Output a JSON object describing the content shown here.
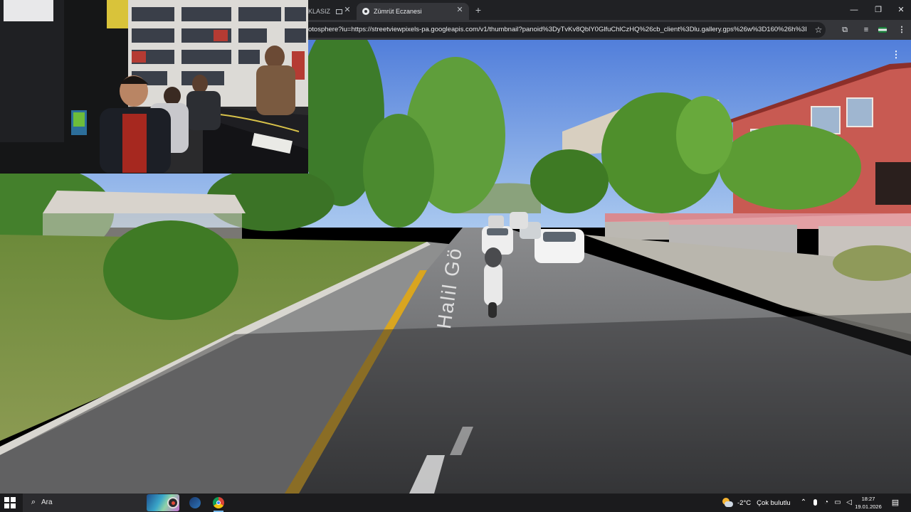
{
  "browser": {
    "tabs": [
      {
        "label": "KLASIZ"
      },
      {
        "label": "Zümrüt Eczanesi"
      }
    ],
    "close_symbol": "✕",
    "new_tab_symbol": "+",
    "window_controls": {
      "minimize": "—",
      "restore": "❐",
      "close": "✕"
    },
    "address": "otosphere?iu=https://streetviewpixels-pa.googleapis.com/v1/thumbnail?panoid%3DyTvKv8QblY0GlfuChlCzHQ%26cb_client%3Dlu.gallery.gps%26w%3D160%26h%3D1...",
    "toolbar_icons": [
      "star-icon",
      "extensions-icon",
      "media-controls-icon",
      "profile-icon",
      "menu-icon"
    ]
  },
  "street_view": {
    "street_label": "Halil Gö",
    "menu_icon": "more-vert-icon"
  },
  "taskbar": {
    "search_placeholder": "Ara",
    "apps": [
      "obs-icon",
      "steam-icon",
      "chrome-icon"
    ],
    "weather": {
      "temperature": "-2°C",
      "condition": "Çok bulutlu"
    },
    "clock": {
      "time": "18:27",
      "date": "19.01.2026"
    },
    "tray_icons": [
      "chevron-up-icon",
      "microphone-icon",
      "meet-icon",
      "network-icon",
      "speaker-icon",
      "notification-icon"
    ]
  }
}
